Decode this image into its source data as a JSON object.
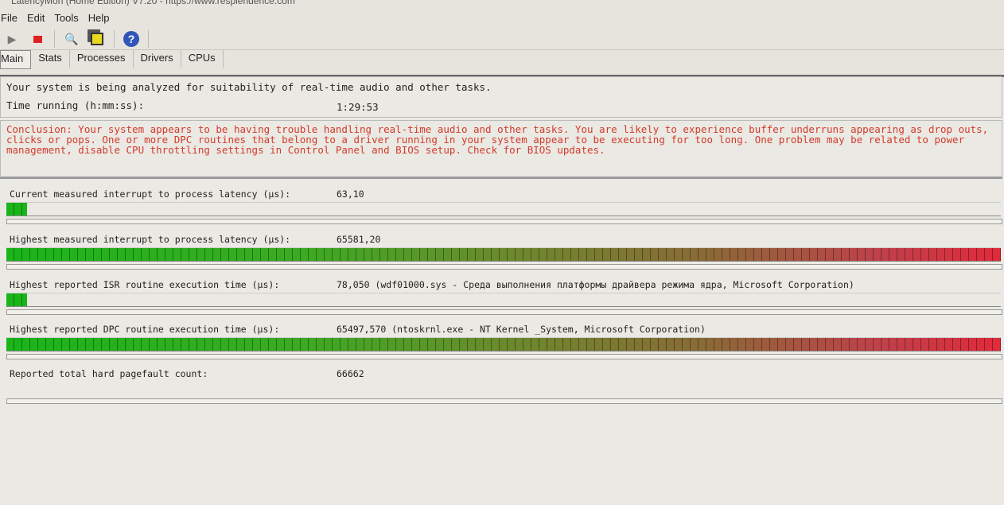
{
  "window": {
    "title": "LatencyMon (Home Edition) V7.20 - https://www.resplendence.com"
  },
  "menu": [
    "File",
    "Edit",
    "Tools",
    "Help"
  ],
  "toolbar": {
    "icons": [
      "play-icon",
      "stop-icon",
      "report-icon",
      "windows-icon",
      "help-icon"
    ]
  },
  "tabs": [
    "Main",
    "Stats",
    "Processes",
    "Drivers",
    "CPUs"
  ],
  "main": {
    "status": "Your system is being analyzed for suitability of real-time audio and other tasks.",
    "time_label": "Time running (h:mm:ss):",
    "time_value": "1:29:53",
    "conclusion": "Conclusion: Your system appears to be having trouble handling real-time audio and other tasks. You are likely to experience buffer underruns appearing as drop outs, clicks or pops. One or more DPC routines that belong to a driver running in your system appear to be executing for too long. One problem may be related to power management, disable CPU throttling settings in Control Panel and BIOS setup. Check for BIOS updates.",
    "metrics": [
      {
        "label": "Current measured interrupt to process latency (µs):",
        "value": "63,10",
        "fill_percent": 2
      },
      {
        "label": "Highest measured interrupt to process latency (µs):",
        "value": "65581,20",
        "fill_percent": 100
      },
      {
        "label": "Highest reported ISR routine execution time (µs):",
        "value": "78,050   (wdf01000.sys - Среда выполнения платформы драйвера режима ядра, Microsoft Corporation)",
        "fill_percent": 2
      },
      {
        "label": "Highest reported DPC routine execution time (µs):",
        "value": "65497,570   (ntoskrnl.exe - NT Kernel _System, Microsoft Corporation)",
        "fill_percent": 100
      },
      {
        "label": "Reported total hard pagefault count:",
        "value": "66662",
        "fill_percent": 0
      }
    ]
  },
  "colors": {
    "conclusion": "#d33a2c",
    "bar_start": "#19b519",
    "bar_end": "#e02a3a"
  }
}
